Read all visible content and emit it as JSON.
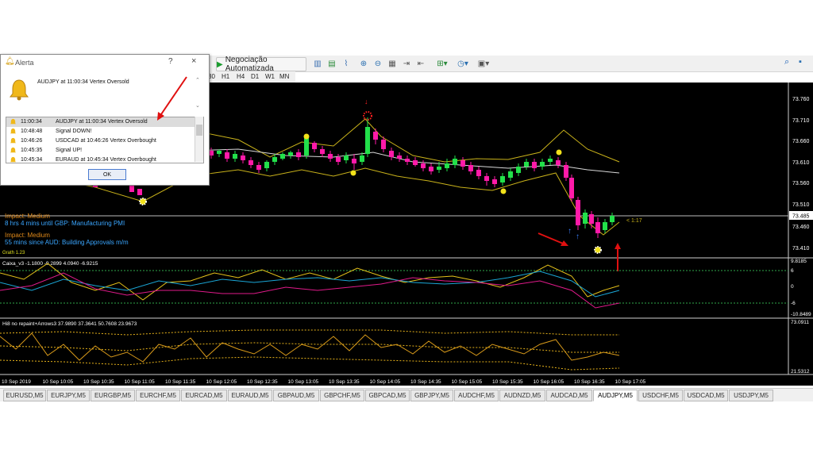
{
  "toolbar": {
    "auto_trading_label": "Negociação Automatizada",
    "timeframes": [
      "30",
      "H1",
      "H4",
      "D1",
      "W1",
      "MN"
    ]
  },
  "alert": {
    "title": "Alerta",
    "help": "?",
    "close": "×",
    "message": "AUDJPY at 11:00:34 Vertex Oversold",
    "ok_label": "OK",
    "rows": [
      {
        "time": "11:00:34",
        "msg": "AUDJPY at 11:00:34 Vertex Oversold"
      },
      {
        "time": "10:48:48",
        "msg": "Signal DOWN!"
      },
      {
        "time": "10:46:26",
        "msg": "USDCAD at 10:46:26 Vertex Overbought"
      },
      {
        "time": "10:45:35",
        "msg": "Signal UP!"
      },
      {
        "time": "10:45:34",
        "msg": "EURAUD at 10:45:34 Vertex Overbought"
      }
    ]
  },
  "chart": {
    "price_labels": [
      "73.760",
      "73.710",
      "73.660",
      "73.610",
      "73.560",
      "73.510",
      "73.460",
      "73.410"
    ],
    "current_price": "73.485",
    "news_line1": "Impact: Medium",
    "news_line2": "8 hrs 4 mins until GBP: Manufacturing PMI",
    "news_line3": "Impact: Medium",
    "news_line4": "55 mins since AUD: Building Approvals m/m",
    "grath_label": "Grath 1.23",
    "timer_label": "< 1:17",
    "ind1_label": "Caixa_v3 -1.1800 -9.2899 4.0940 -6.9215",
    "ind1_scale": [
      "9.8185",
      "6",
      "0",
      "-6",
      "-10.8489"
    ],
    "ind2_label": "Hi8 no repaint+Arrows3 37.9890 37.3641 50.7608 23.9673",
    "ind2_scale": [
      "73.0911",
      "21.5312"
    ],
    "time_labels": [
      "10 Sep 2019",
      "10 Sep 10:05",
      "10 Sep 10:35",
      "10 Sep 11:05",
      "10 Sep 11:35",
      "10 Sep 12:05",
      "10 Sep 12:35",
      "10 Sep 13:05",
      "10 Sep 13:35",
      "10 Sep 14:05",
      "10 Sep 14:35",
      "10 Sep 15:05",
      "10 Sep 15:35",
      "10 Sep 16:05",
      "10 Sep 16:35",
      "10 Sep 17:05"
    ]
  },
  "tabs": [
    "EURUSD,M5",
    "EURJPY,M5",
    "EURGBP,M5",
    "EURCHF,M5",
    "EURCAD,M5",
    "EURAUD,M5",
    "GBPAUD,M5",
    "GBPCHF,M5",
    "GBPCAD,M5",
    "GBPJPY,M5",
    "AUDCHF,M5",
    "AUDNZD,M5",
    "AUDCAD,M5",
    "AUDJPY,M5",
    "USDCHF,M5",
    "USDCAD,M5",
    "USDJPY,M5"
  ],
  "active_tab": "AUDJPY,M5",
  "colors": {
    "bull": "#22e04a",
    "bear": "#ff1aa8",
    "band": "#c9b21a",
    "ma": "#d8d8d8",
    "alert_arrow": "#e01010"
  }
}
